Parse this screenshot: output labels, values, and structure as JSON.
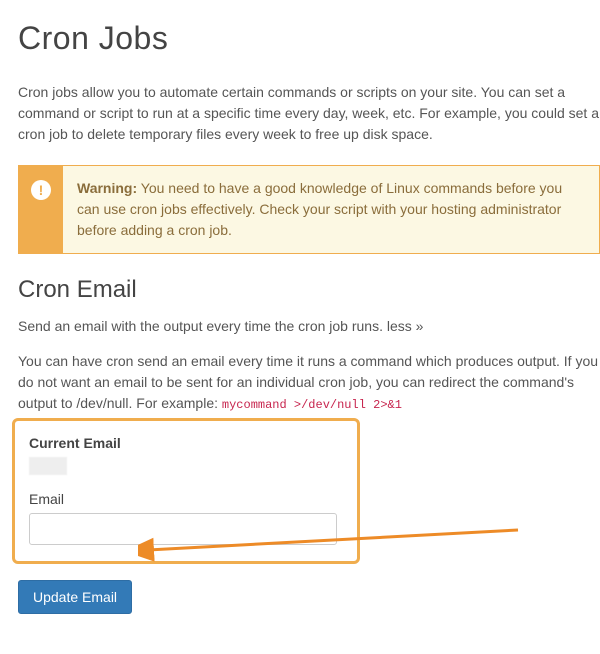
{
  "page_title": "Cron Jobs",
  "intro_text": "Cron jobs allow you to automate certain commands or scripts on your site. You can set a command or script to run at a specific time every day, week, etc. For example, you could set a cron job to delete temporary files every week to free up disk space.",
  "warning": {
    "label": "Warning:",
    "text": " You need to have a good knowledge of Linux commands before you can use cron jobs effectively. Check your script with your hosting administrator before adding a cron job."
  },
  "section_title": "Cron Email",
  "subtitle_text": "Send an email with the output every time the cron job runs. ",
  "less_link": "less »",
  "description_prefix": "You can have cron send an email every time it runs a command which produces output. If you do not want an email to be sent for an individual cron job, you can redirect the command's output to /dev/null. For example: ",
  "example_code": "mycommand >/dev/null 2>&1",
  "form": {
    "current_email_label": "Current Email",
    "current_email_value": "",
    "email_label": "Email",
    "email_value": "",
    "submit_label": "Update Email"
  }
}
